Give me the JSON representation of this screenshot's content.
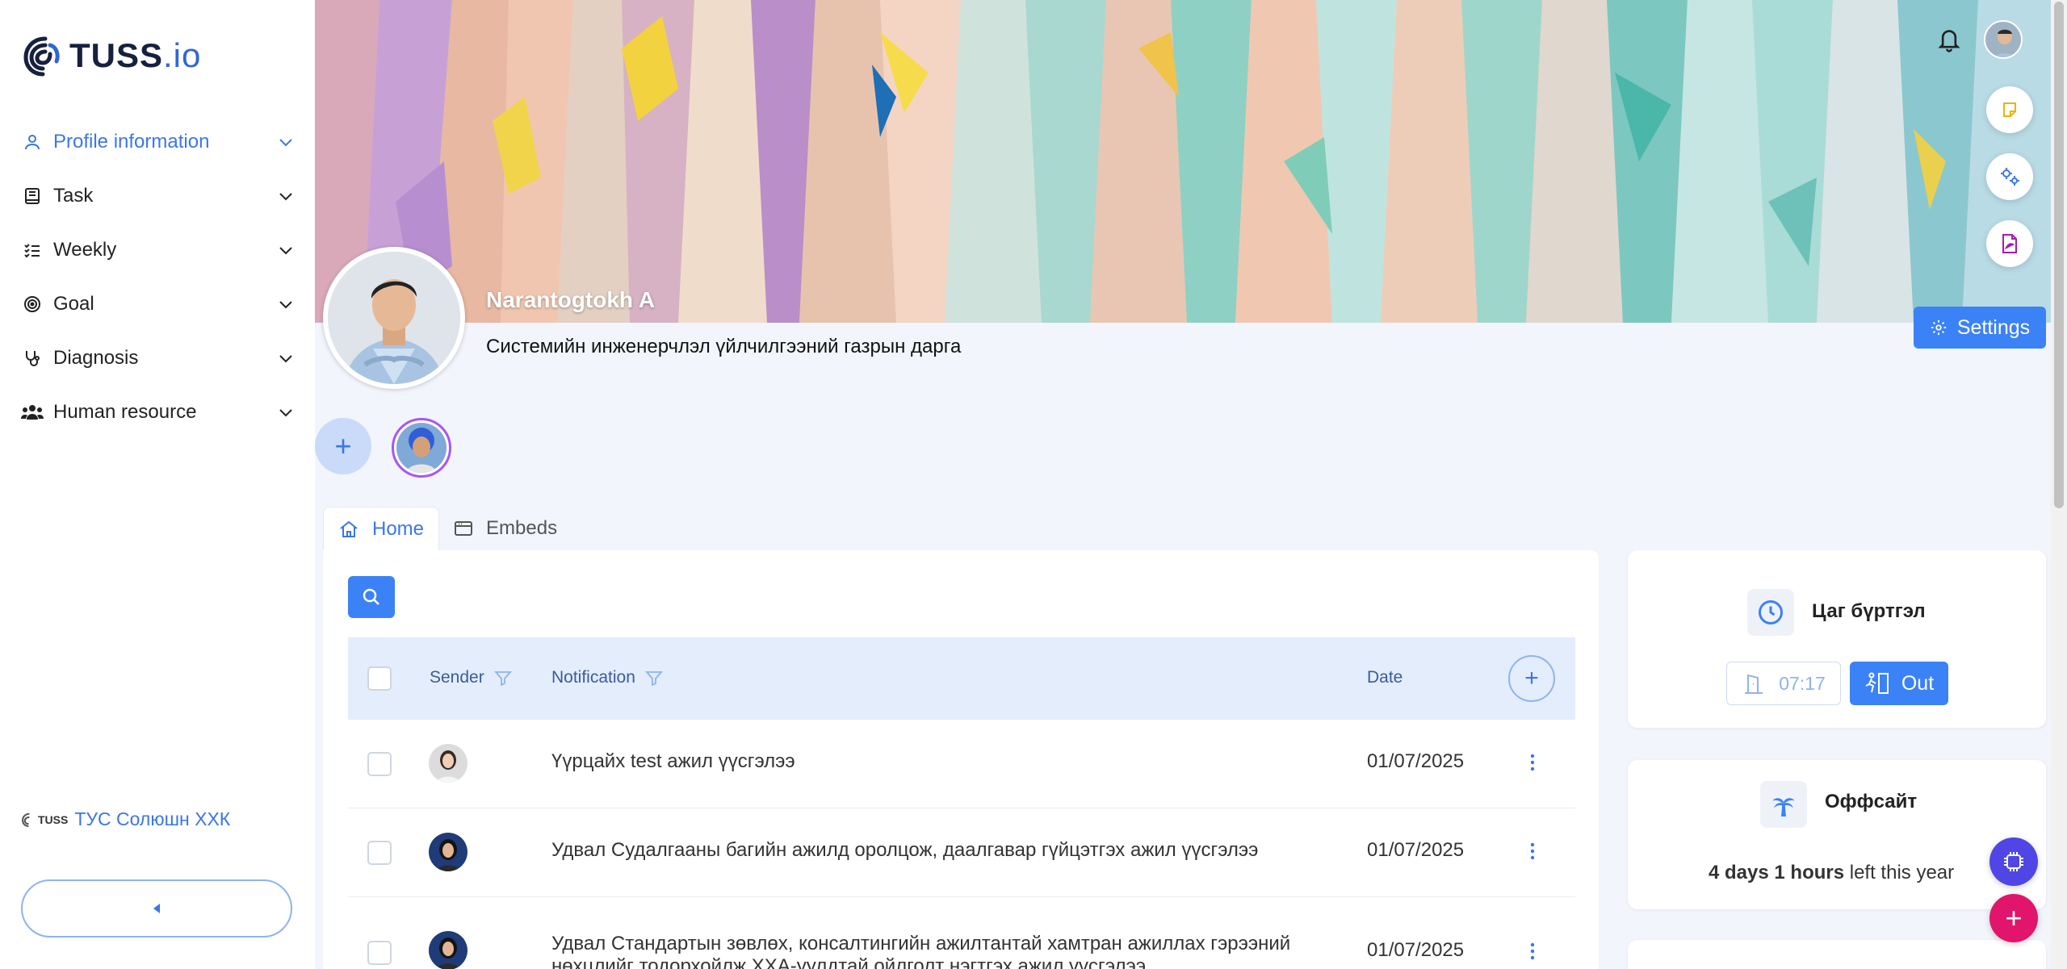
{
  "brand": {
    "logo_main": "TUSS",
    "logo_suffix": ".io"
  },
  "sidebar": {
    "items": [
      {
        "label": "Profile information",
        "icon": "user-icon",
        "active": true
      },
      {
        "label": "Task",
        "icon": "book-icon"
      },
      {
        "label": "Weekly",
        "icon": "checklist-icon"
      },
      {
        "label": "Goal",
        "icon": "target-icon"
      },
      {
        "label": "Diagnosis",
        "icon": "stethoscope-icon"
      },
      {
        "label": "Human resource",
        "icon": "users-icon"
      }
    ],
    "company_logo_text": "TUSS",
    "company_name": "ТУС Солюшн ХХК"
  },
  "profile": {
    "name": "Narantogtokh A",
    "title": "Системийн инженерчлэл үйлчилгээний газрын дарга",
    "settings_label": "Settings"
  },
  "tabs": [
    {
      "label": "Home",
      "icon": "home-icon",
      "active": true
    },
    {
      "label": "Embeds",
      "icon": "window-icon"
    }
  ],
  "table": {
    "columns": {
      "sender": "Sender",
      "notification": "Notification",
      "date": "Date"
    },
    "rows": [
      {
        "notification": "Үүрцайх test ажил үүсгэлээ",
        "date": "01/07/2025"
      },
      {
        "notification": "Удвал Судалгааны багийн ажилд оролцож, даалгавар гүйцэтгэх ажил үүсгэлээ",
        "date": "01/07/2025"
      },
      {
        "notification": "Удвал Стандартын зөвлөх, консалтингийн ажилтантай хамтран ажиллах гэрээний нөхцлийг тодорхойлж ХХА-уулдтай ойлголт нэгтгэх ажил үүсгэлээ",
        "date": "01/07/2025"
      }
    ]
  },
  "time_card": {
    "title": "Цаг бүртгэл",
    "time": "07:17",
    "out_label": "Out"
  },
  "offsite_card": {
    "title": "Оффсайт",
    "amount": "4 days 1 hours",
    "suffix": " left this year"
  },
  "colors": {
    "accent": "#3b82f6",
    "ai_fab": "#4f46e5",
    "plus_fab": "#e0156b"
  }
}
